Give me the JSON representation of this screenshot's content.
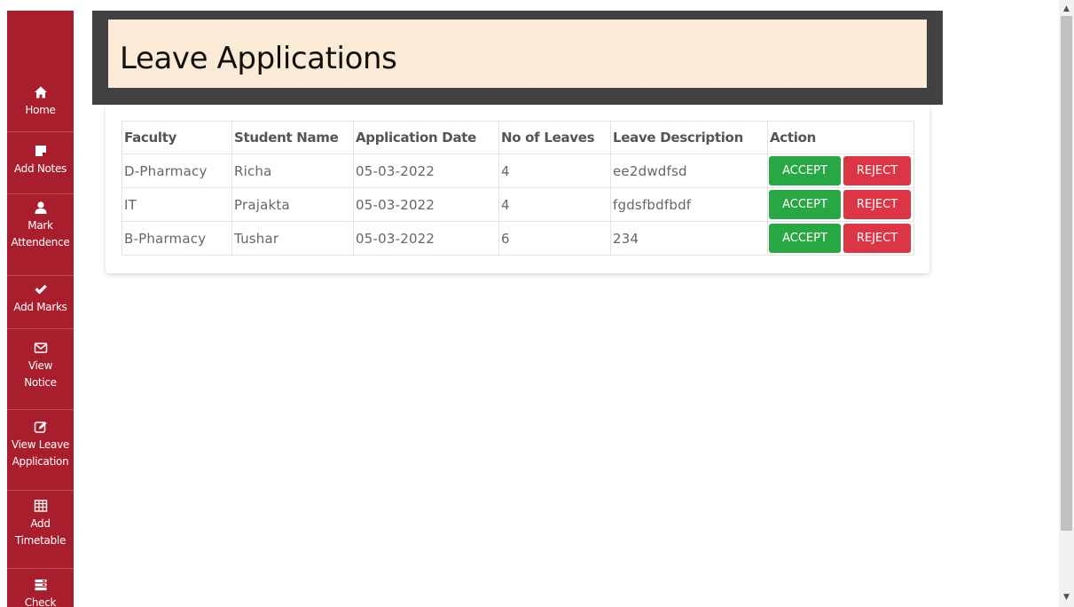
{
  "header": {
    "title": "Leave Applications"
  },
  "sidebar": {
    "items": [
      {
        "label_lines": [
          "Home"
        ],
        "icon": "home-icon"
      },
      {
        "label_lines": [
          "Add Notes"
        ],
        "icon": "sticky-note-icon"
      },
      {
        "label_lines": [
          "Mark",
          "Attendence"
        ],
        "icon": "user-icon"
      },
      {
        "label_lines": [
          "Add Marks"
        ],
        "icon": "check-icon"
      },
      {
        "label_lines": [
          "View",
          "Notice"
        ],
        "icon": "envelope-icon"
      },
      {
        "label_lines": [
          "View Leave",
          "Application"
        ],
        "icon": "edit-icon"
      },
      {
        "label_lines": [
          "Add",
          "Timetable"
        ],
        "icon": "table-icon"
      },
      {
        "label_lines": [
          "Check"
        ],
        "icon": "list-icon"
      }
    ]
  },
  "table": {
    "headers": [
      "Faculty",
      "Student Name",
      "Application Date",
      "No of Leaves",
      "Leave Description",
      "Action"
    ],
    "rows": [
      {
        "faculty": "D-Pharmacy",
        "student": "Richa",
        "date": "05-03-2022",
        "leaves": "4",
        "description": "ee2dwdfsd"
      },
      {
        "faculty": "IT",
        "student": "Prajakta",
        "date": "05-03-2022",
        "leaves": "4",
        "description": "fgdsfbdfbdf"
      },
      {
        "faculty": "B-Pharmacy",
        "student": "Tushar",
        "date": "05-03-2022",
        "leaves": "6",
        "description": "234"
      }
    ],
    "accept_label": "ACCEPT",
    "reject_label": "REJECT"
  },
  "colors": {
    "sidebar_bg": "#a91e2c",
    "header_frame": "#414141",
    "header_bg": "#fbead5",
    "accept": "#28a745",
    "reject": "#dc3545"
  }
}
